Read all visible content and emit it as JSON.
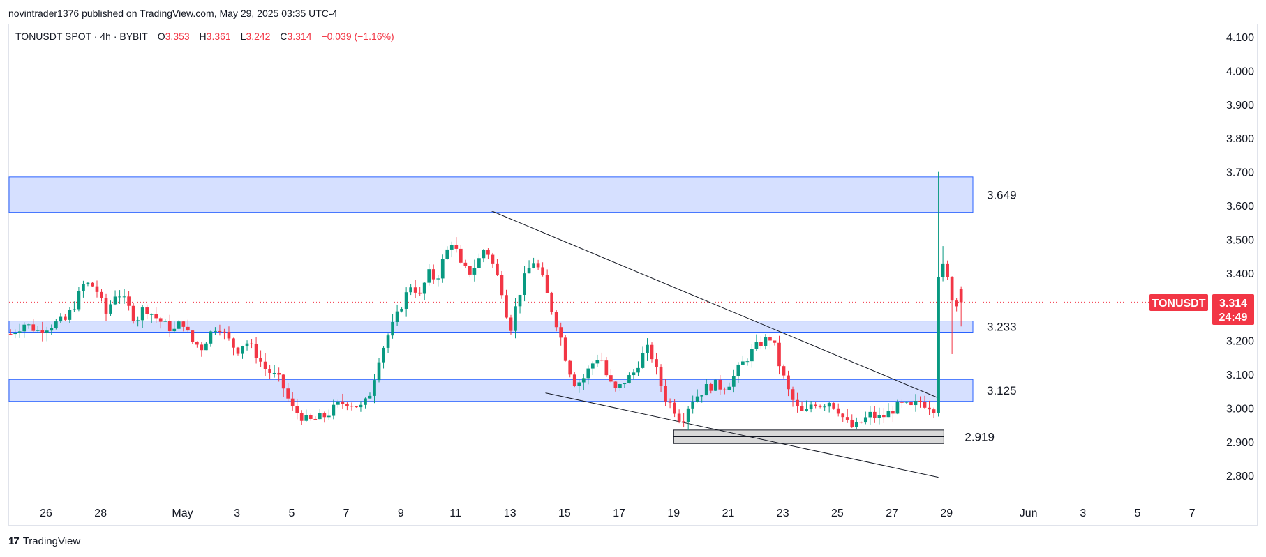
{
  "publisher_line": "novintrader1376 published on TradingView.com, May 29, 2025 03:35 UTC-4",
  "footer": {
    "brand": "TradingView"
  },
  "colors": {
    "up": "#089981",
    "down": "#f23645",
    "zone_fill": "#d6e0ff",
    "zone_border": "#2962ff",
    "base_fill": "#d9d9d9"
  },
  "legend": {
    "symbol": "TONUSDT SPOT · 4h · BYBIT",
    "o_label": "O",
    "o_value": "3.353",
    "h_label": "H",
    "h_value": "3.361",
    "l_label": "L",
    "l_value": "3.242",
    "c_label": "C",
    "c_value": "3.314",
    "change": "−0.039 (−1.16%)"
  },
  "price_badge": {
    "symbol": "TONUSDT",
    "price": "3.314",
    "countdown": "24:49"
  },
  "chart_data": {
    "type": "candlestick",
    "symbol": "TONUSDT",
    "interval": "4h",
    "exchange": "BYBIT",
    "x_axis": {
      "ticks": [
        {
          "label": "26",
          "day": 0
        },
        {
          "label": "28",
          "day": 2
        },
        {
          "label": "May",
          "day": 5
        },
        {
          "label": "3",
          "day": 7
        },
        {
          "label": "5",
          "day": 9
        },
        {
          "label": "7",
          "day": 11
        },
        {
          "label": "9",
          "day": 13
        },
        {
          "label": "11",
          "day": 15
        },
        {
          "label": "13",
          "day": 17
        },
        {
          "label": "15",
          "day": 19
        },
        {
          "label": "17",
          "day": 21
        },
        {
          "label": "19",
          "day": 23
        },
        {
          "label": "21",
          "day": 25
        },
        {
          "label": "23",
          "day": 27
        },
        {
          "label": "25",
          "day": 29
        },
        {
          "label": "27",
          "day": 31
        },
        {
          "label": "29",
          "day": 33
        },
        {
          "label": "Jun",
          "day": 36
        },
        {
          "label": "3",
          "day": 38
        },
        {
          "label": "5",
          "day": 40
        },
        {
          "label": "7",
          "day": 42
        }
      ]
    },
    "y_axis": {
      "ticks": [
        "4.100",
        "4.000",
        "3.900",
        "3.800",
        "3.700",
        "3.600",
        "3.500",
        "3.400",
        "3.200",
        "3.100",
        "3.000",
        "2.900",
        "2.800"
      ],
      "range": [
        2.73,
        4.18
      ]
    },
    "last_price": 3.314,
    "zones": [
      {
        "label": "3.649",
        "top": 3.685,
        "bottom": 3.58,
        "kind": "resistance"
      },
      {
        "label": "3.233",
        "top": 3.258,
        "bottom": 3.225,
        "kind": "support"
      },
      {
        "label": "3.125",
        "top": 3.085,
        "bottom": 3.02,
        "kind": "support"
      },
      {
        "label": "2.919",
        "top": 2.935,
        "bottom": 2.895,
        "kind": "base"
      }
    ],
    "trendlines": [
      {
        "name": "upper",
        "from": {
          "day": 16.3,
          "price": 3.585
        },
        "to": {
          "day": 32.7,
          "price": 3.03
        }
      },
      {
        "name": "lower",
        "from": {
          "day": 18.3,
          "price": 3.045
        },
        "to": {
          "day": 32.7,
          "price": 2.795
        }
      }
    ],
    "anchors": [
      {
        "day": -1.3,
        "price": 3.22
      },
      {
        "day": -0.8,
        "price": 3.25
      },
      {
        "day": -0.3,
        "price": 3.23
      },
      {
        "day": 0.3,
        "price": 3.25
      },
      {
        "day": 0.7,
        "price": 3.26
      },
      {
        "day": 1.0,
        "price": 3.3
      },
      {
        "day": 1.4,
        "price": 3.37
      },
      {
        "day": 1.8,
        "price": 3.36
      },
      {
        "day": 2.2,
        "price": 3.28
      },
      {
        "day": 2.6,
        "price": 3.35
      },
      {
        "day": 3.0,
        "price": 3.3
      },
      {
        "day": 3.3,
        "price": 3.26
      },
      {
        "day": 3.6,
        "price": 3.3
      },
      {
        "day": 4.0,
        "price": 3.27
      },
      {
        "day": 4.3,
        "price": 3.25
      },
      {
        "day": 4.7,
        "price": 3.23
      },
      {
        "day": 5.0,
        "price": 3.26
      },
      {
        "day": 5.3,
        "price": 3.2
      },
      {
        "day": 5.7,
        "price": 3.18
      },
      {
        "day": 6.0,
        "price": 3.22
      },
      {
        "day": 6.3,
        "price": 3.25
      },
      {
        "day": 6.6,
        "price": 3.21
      },
      {
        "day": 7.0,
        "price": 3.17
      },
      {
        "day": 7.3,
        "price": 3.2
      },
      {
        "day": 7.7,
        "price": 3.16
      },
      {
        "day": 8.0,
        "price": 3.12
      },
      {
        "day": 8.3,
        "price": 3.1
      },
      {
        "day": 8.6,
        "price": 3.08
      },
      {
        "day": 9.0,
        "price": 3.0
      },
      {
        "day": 9.3,
        "price": 2.98
      },
      {
        "day": 9.6,
        "price": 2.96
      },
      {
        "day": 10.0,
        "price": 2.97
      },
      {
        "day": 10.3,
        "price": 2.98
      },
      {
        "day": 10.7,
        "price": 3.01
      },
      {
        "day": 11.0,
        "price": 3.02
      },
      {
        "day": 11.3,
        "price": 3.01
      },
      {
        "day": 11.6,
        "price": 3.0
      },
      {
        "day": 11.9,
        "price": 3.05
      },
      {
        "day": 12.2,
        "price": 3.15
      },
      {
        "day": 12.5,
        "price": 3.21
      },
      {
        "day": 12.8,
        "price": 3.26
      },
      {
        "day": 13.1,
        "price": 3.32
      },
      {
        "day": 13.4,
        "price": 3.37
      },
      {
        "day": 13.7,
        "price": 3.33
      },
      {
        "day": 14.0,
        "price": 3.4
      },
      {
        "day": 14.3,
        "price": 3.38
      },
      {
        "day": 14.6,
        "price": 3.45
      },
      {
        "day": 14.9,
        "price": 3.5
      },
      {
        "day": 15.2,
        "price": 3.42
      },
      {
        "day": 15.5,
        "price": 3.4
      },
      {
        "day": 15.8,
        "price": 3.43
      },
      {
        "day": 16.1,
        "price": 3.48
      },
      {
        "day": 16.4,
        "price": 3.42
      },
      {
        "day": 16.7,
        "price": 3.35
      },
      {
        "day": 17.0,
        "price": 3.23
      },
      {
        "day": 17.3,
        "price": 3.33
      },
      {
        "day": 17.6,
        "price": 3.4
      },
      {
        "day": 17.9,
        "price": 3.44
      },
      {
        "day": 18.2,
        "price": 3.38
      },
      {
        "day": 18.5,
        "price": 3.3
      },
      {
        "day": 18.8,
        "price": 3.23
      },
      {
        "day": 19.1,
        "price": 3.13
      },
      {
        "day": 19.4,
        "price": 3.07
      },
      {
        "day": 19.7,
        "price": 3.09
      },
      {
        "day": 20.0,
        "price": 3.13
      },
      {
        "day": 20.3,
        "price": 3.16
      },
      {
        "day": 20.6,
        "price": 3.08
      },
      {
        "day": 20.9,
        "price": 3.05
      },
      {
        "day": 21.2,
        "price": 3.08
      },
      {
        "day": 21.5,
        "price": 3.1
      },
      {
        "day": 21.8,
        "price": 3.15
      },
      {
        "day": 22.1,
        "price": 3.18
      },
      {
        "day": 22.4,
        "price": 3.1
      },
      {
        "day": 22.7,
        "price": 3.03
      },
      {
        "day": 23.0,
        "price": 3.0
      },
      {
        "day": 23.3,
        "price": 2.96
      },
      {
        "day": 23.6,
        "price": 3.02
      },
      {
        "day": 23.9,
        "price": 3.04
      },
      {
        "day": 24.2,
        "price": 3.06
      },
      {
        "day": 24.5,
        "price": 3.07
      },
      {
        "day": 24.8,
        "price": 3.06
      },
      {
        "day": 25.1,
        "price": 3.08
      },
      {
        "day": 25.4,
        "price": 3.12
      },
      {
        "day": 25.7,
        "price": 3.15
      },
      {
        "day": 26.0,
        "price": 3.18
      },
      {
        "day": 26.3,
        "price": 3.2
      },
      {
        "day": 26.6,
        "price": 3.21
      },
      {
        "day": 26.9,
        "price": 3.12
      },
      {
        "day": 27.2,
        "price": 3.05
      },
      {
        "day": 27.5,
        "price": 3.0
      },
      {
        "day": 27.8,
        "price": 2.98
      },
      {
        "day": 28.1,
        "price": 3.02
      },
      {
        "day": 28.4,
        "price": 3.01
      },
      {
        "day": 28.7,
        "price": 3.02
      },
      {
        "day": 29.0,
        "price": 3.0
      },
      {
        "day": 29.3,
        "price": 2.96
      },
      {
        "day": 29.6,
        "price": 2.94
      },
      {
        "day": 29.9,
        "price": 2.96
      },
      {
        "day": 30.2,
        "price": 2.98
      },
      {
        "day": 30.5,
        "price": 2.97
      },
      {
        "day": 30.8,
        "price": 2.98
      },
      {
        "day": 31.1,
        "price": 3.0
      },
      {
        "day": 31.4,
        "price": 3.01
      },
      {
        "day": 31.7,
        "price": 3.0
      },
      {
        "day": 32.0,
        "price": 3.02
      },
      {
        "day": 32.3,
        "price": 3.01
      },
      {
        "day": 32.55,
        "price": 3.0
      },
      {
        "day": 32.7,
        "price": 3.4
      },
      {
        "day": 32.9,
        "price": 3.42
      },
      {
        "day": 33.1,
        "price": 3.36
      },
      {
        "day": 33.3,
        "price": 3.3
      },
      {
        "day": 33.5,
        "price": 3.314
      }
    ]
  }
}
